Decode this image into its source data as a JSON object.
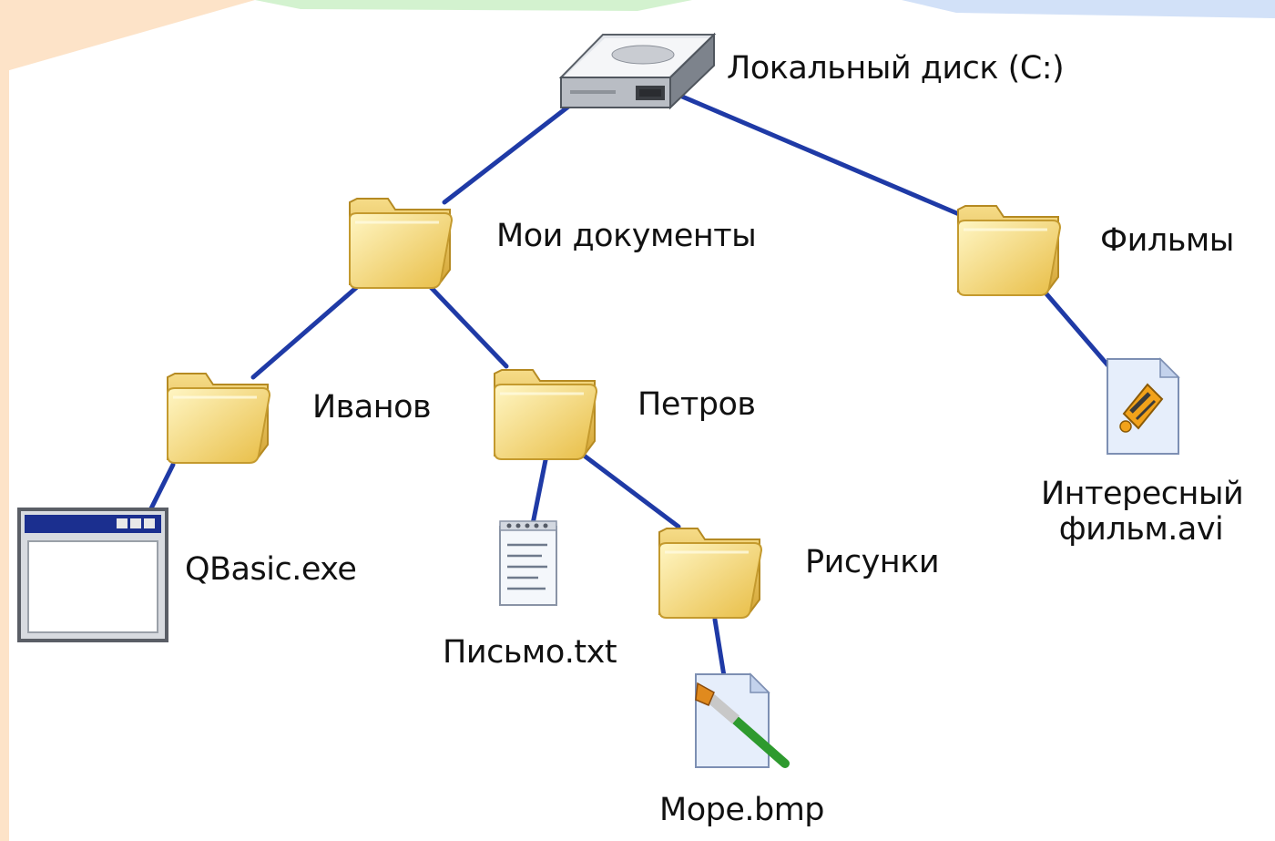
{
  "colors": {
    "edge": "#1f3aa6",
    "folder_light": "#fff3b0",
    "folder_dark": "#e9c04f",
    "folder_outline": "#c8a23c",
    "background_peach": "#fde3c8",
    "background_green": "#d3f2cf",
    "background_blue": "#d2e1f8"
  },
  "tree": {
    "nodes": [
      {
        "id": "drive",
        "icon": "hard-drive-icon",
        "label": "Локальный диск (C:)",
        "parent": null
      },
      {
        "id": "moi_dokumenty",
        "icon": "folder-icon",
        "label": "Мои документы",
        "parent": "drive"
      },
      {
        "id": "filmy",
        "icon": "folder-icon",
        "label": "Фильмы",
        "parent": "drive"
      },
      {
        "id": "ivanov",
        "icon": "folder-icon",
        "label": "Иванов",
        "parent": "moi_dokumenty"
      },
      {
        "id": "petrov",
        "icon": "folder-icon",
        "label": "Петров",
        "parent": "moi_dokumenty"
      },
      {
        "id": "qbasic",
        "icon": "application-window-icon",
        "label": "QBasic.exe",
        "parent": "ivanov"
      },
      {
        "id": "pismo",
        "icon": "text-document-icon",
        "label": "Письмо.txt",
        "parent": "petrov"
      },
      {
        "id": "risunki",
        "icon": "folder-icon",
        "label": "Рисунки",
        "parent": "petrov"
      },
      {
        "id": "more",
        "icon": "image-file-icon",
        "label": "Море.bmp",
        "parent": "risunki"
      },
      {
        "id": "film",
        "icon": "video-file-icon",
        "label": "Интересный фильм.avi",
        "parent": "filmy"
      }
    ]
  }
}
